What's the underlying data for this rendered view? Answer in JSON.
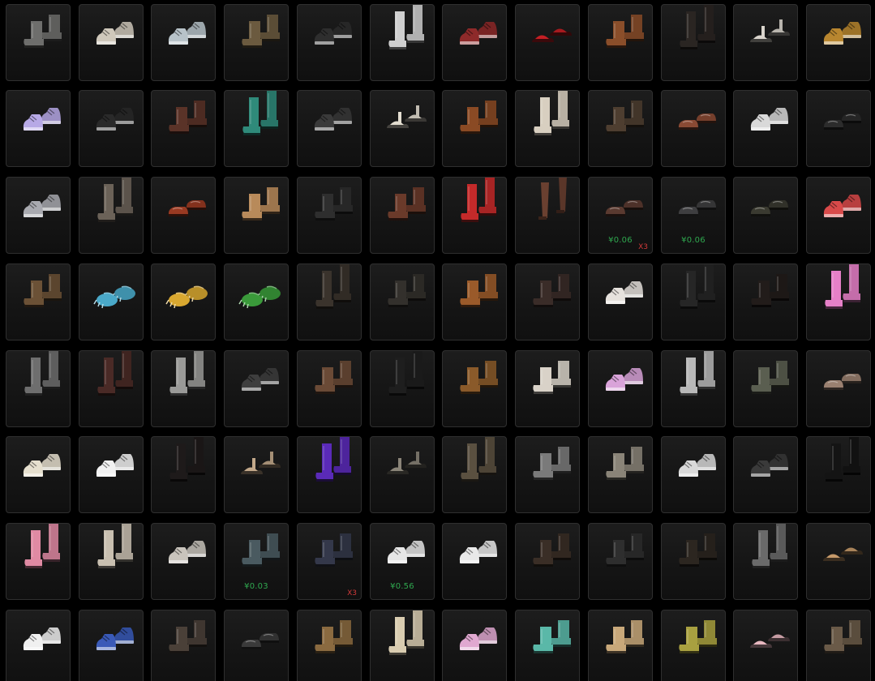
{
  "inventory": {
    "rows": [
      [
        {
          "item": "boots",
          "color": "#6e6e6c"
        },
        {
          "item": "sneakers",
          "color": "#cfc8bb"
        },
        {
          "item": "sneakers",
          "color": "#b8c3c9"
        },
        {
          "item": "boots",
          "color": "#6b5a3f"
        },
        {
          "item": "sneakers",
          "color": "#2e2e2e"
        },
        {
          "item": "knee-boots",
          "color": "#cfcfcf"
        },
        {
          "item": "sneakers",
          "color": "#8e2a2a"
        },
        {
          "item": "slides",
          "color": "#c41f24"
        },
        {
          "item": "boots",
          "color": "#8a4e2a"
        },
        {
          "item": "knee-boots",
          "color": "#2a2522"
        },
        {
          "item": "sandals",
          "color": "#d9d4cc"
        },
        {
          "item": "sneakers",
          "color": "#b8862f"
        }
      ],
      [
        {
          "item": "sneakers",
          "color": "#b7a9e6"
        },
        {
          "item": "sneakers",
          "color": "#2a2a2a"
        },
        {
          "item": "boots",
          "color": "#5a3328"
        },
        {
          "item": "knee-boots",
          "color": "#2f8a7a"
        },
        {
          "item": "sneakers",
          "color": "#3a3a3a"
        },
        {
          "item": "sandals",
          "color": "#e3ddd0"
        },
        {
          "item": "boots",
          "color": "#8a4a24"
        },
        {
          "item": "knee-boots",
          "color": "#d8cfc0"
        },
        {
          "item": "boots",
          "color": "#4e3e30"
        },
        {
          "item": "loafers",
          "color": "#8a4a34"
        },
        {
          "item": "sneakers",
          "color": "#d9d9d9"
        },
        {
          "item": "loafers",
          "color": "#2c2c2c"
        }
      ],
      [
        {
          "item": "sneakers",
          "color": "#a9aab0"
        },
        {
          "item": "knee-boots",
          "color": "#6b6258"
        },
        {
          "item": "loafers",
          "color": "#9a3a22"
        },
        {
          "item": "boots",
          "color": "#b88a5a"
        },
        {
          "item": "boots",
          "color": "#2e2e2e"
        },
        {
          "item": "boots",
          "color": "#6a3a2a"
        },
        {
          "item": "knee-boots",
          "color": "#c42a2a"
        },
        {
          "item": "stockings",
          "color": "#6a4030"
        },
        {
          "item": "loafers",
          "color": "#5a3a30",
          "price": "¥0.06",
          "qty": "X3"
        },
        {
          "item": "loafers",
          "color": "#3e3e40",
          "price": "¥0.06"
        },
        {
          "item": "loafers",
          "color": "#3a3a30"
        },
        {
          "item": "sneakers",
          "color": "#d94a4a"
        }
      ],
      [
        {
          "item": "boots",
          "color": "#6b5136"
        },
        {
          "item": "paws",
          "color": "#4aa9c9"
        },
        {
          "item": "paws",
          "color": "#d9a830"
        },
        {
          "item": "paws",
          "color": "#3a9a3a"
        },
        {
          "item": "knee-boots",
          "color": "#3a332c"
        },
        {
          "item": "boots",
          "color": "#33302c"
        },
        {
          "item": "boots",
          "color": "#9a5a2a"
        },
        {
          "item": "boots",
          "color": "#3a2c28"
        },
        {
          "item": "sneakers",
          "color": "#e6e2dd"
        },
        {
          "item": "knee-boots",
          "color": "#262626"
        },
        {
          "item": "boots",
          "color": "#221c1a"
        },
        {
          "item": "knee-boots",
          "color": "#e680c8"
        }
      ],
      [
        {
          "item": "knee-boots",
          "color": "#6e6e6e"
        },
        {
          "item": "knee-boots",
          "color": "#4a2a26"
        },
        {
          "item": "knee-boots",
          "color": "#9a9a98"
        },
        {
          "item": "sneakers",
          "color": "#3e3e3e"
        },
        {
          "item": "boots",
          "color": "#6a4a36"
        },
        {
          "item": "knee-boots",
          "color": "#1e1e1e"
        },
        {
          "item": "boots",
          "color": "#8a5a2a"
        },
        {
          "item": "boots",
          "color": "#d9d2c8"
        },
        {
          "item": "sneakers",
          "color": "#d9a3d9"
        },
        {
          "item": "knee-boots",
          "color": "#b8b8b8"
        },
        {
          "item": "boots",
          "color": "#5a5e50"
        },
        {
          "item": "loafers",
          "color": "#9a8070"
        }
      ],
      [
        {
          "item": "sneakers",
          "color": "#e6e0cf"
        },
        {
          "item": "sneakers",
          "color": "#f2f2f2"
        },
        {
          "item": "knee-boots",
          "color": "#1e1a1a"
        },
        {
          "item": "sandals",
          "color": "#c2a88a"
        },
        {
          "item": "knee-boots",
          "color": "#5a2ab8"
        },
        {
          "item": "sandals",
          "color": "#8a8478"
        },
        {
          "item": "knee-boots",
          "color": "#5a5040"
        },
        {
          "item": "boots",
          "color": "#7a7a7a"
        },
        {
          "item": "boots",
          "color": "#8a8478"
        },
        {
          "item": "sneakers",
          "color": "#d9d9d9"
        },
        {
          "item": "sneakers",
          "color": "#3a3a3a"
        },
        {
          "item": "knee-boots",
          "color": "#141414"
        }
      ],
      [
        {
          "item": "knee-boots",
          "color": "#e08aa3"
        },
        {
          "item": "knee-boots",
          "color": "#c8bfb0"
        },
        {
          "item": "sneakers",
          "color": "#c9c4bc"
        },
        {
          "item": "boots",
          "color": "#4a5a60",
          "price": "¥0.03"
        },
        {
          "item": "boots",
          "color": "#34384a",
          "qty": "X3"
        },
        {
          "item": "sneakers",
          "color": "#e6e6e6",
          "price": "¥0.56"
        },
        {
          "item": "sneakers",
          "color": "#e9e9e9"
        },
        {
          "item": "boots",
          "color": "#3a2e26"
        },
        {
          "item": "boots",
          "color": "#2e2e2e"
        },
        {
          "item": "boots",
          "color": "#2c2620"
        },
        {
          "item": "knee-boots",
          "color": "#6a6a6a"
        },
        {
          "item": "slides",
          "color": "#c69a6a"
        }
      ],
      [
        {
          "item": "sneakers",
          "color": "#f0f0f0"
        },
        {
          "item": "sneakers",
          "color": "#3a5ab8"
        },
        {
          "item": "boots",
          "color": "#4a4038"
        },
        {
          "item": "loafers",
          "color": "#3a3a3a"
        },
        {
          "item": "boots",
          "color": "#8a6a40"
        },
        {
          "item": "knee-boots",
          "color": "#d9ccb0"
        },
        {
          "item": "sneakers",
          "color": "#e0a8d0"
        },
        {
          "item": "boots",
          "color": "#5ab8a8"
        },
        {
          "item": "boots",
          "color": "#c8a87a"
        },
        {
          "item": "boots",
          "color": "#a8a040"
        },
        {
          "item": "slides",
          "color": "#e8b8c0"
        },
        {
          "item": "boots",
          "color": "#6a5a48"
        }
      ]
    ]
  }
}
